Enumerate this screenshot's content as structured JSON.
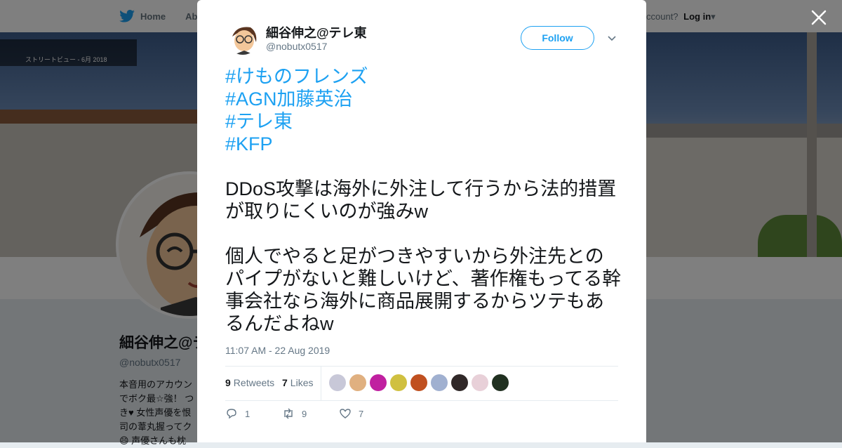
{
  "topbar": {
    "home_label": "Home",
    "about_label": "Abo",
    "account_prompt": "ccount?",
    "login_label": "Log in"
  },
  "banner": {
    "streetview_label": "ストリートビュー - 6月 2018"
  },
  "profile": {
    "name": "細谷伸之@テ",
    "handle": "@nobutx0517",
    "bio": "本音用のアカウン\nでボク最☆強！ つ\nき♥ 女性声優を恨\n司の葦丸握ってク\n😄 声優さんも枕"
  },
  "tweet": {
    "author_name": "細谷伸之@テレ東",
    "author_handle": "@nobutx0517",
    "follow_label": "Follow",
    "hashtags": [
      "#けものフレンズ",
      "#AGN加藤英治",
      "#テレ東",
      "#KFP"
    ],
    "paragraphs": [
      "DDoS攻撃は海外に外注して行うから法的措置が取りにくいのが強みw",
      "個人でやると足がつきやすいから外注先とのパイプがないと難しいけど、著作権もってる幹事会社なら海外に商品展開するからツテもあるんだよねw"
    ],
    "timestamp": "11:07 AM - 22 Aug 2019",
    "retweet_count": "9",
    "retweets_label": "Retweets",
    "like_count": "7",
    "likes_label": "Likes",
    "reply_action_count": "1",
    "retweet_action_count": "9",
    "like_action_count": "7"
  },
  "liker_colors": [
    "#c8c8d8",
    "#e0b080",
    "#c020a0",
    "#d0c040",
    "#c05020",
    "#a0b0d0",
    "#302828",
    "#e8d0d8",
    "#203020"
  ],
  "colors": {
    "accent": "#1da1f2",
    "text": "#14171a",
    "muted": "#657786"
  }
}
